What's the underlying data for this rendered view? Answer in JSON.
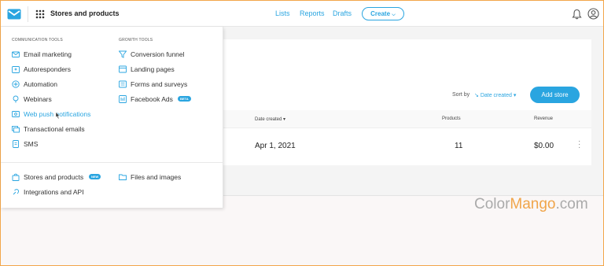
{
  "header": {
    "app_title": "Stores and products",
    "nav": [
      "Lists",
      "Reports",
      "Drafts"
    ],
    "create_label": "Create",
    "accent": "#2aa5e0"
  },
  "content": {
    "sort_label": "Sort by",
    "sort_value": "Date created",
    "add_store_label": "Add store",
    "columns": [
      "Date created",
      "Products",
      "Revenue"
    ],
    "rows": [
      {
        "date": "Apr 1, 2021",
        "products": "11",
        "revenue": "$0.00"
      }
    ]
  },
  "menu": {
    "communication_title": "COMMUNICATION TOOLS",
    "growth_title": "GROWTH TOOLS",
    "communication_items": [
      {
        "label": "Email marketing",
        "icon": "envelope-icon"
      },
      {
        "label": "Autoresponders",
        "icon": "autoresponder-icon"
      },
      {
        "label": "Automation",
        "icon": "automation-icon"
      },
      {
        "label": "Webinars",
        "icon": "webinar-icon"
      },
      {
        "label": "Web push notifications",
        "icon": "web-push-icon"
      },
      {
        "label": "Transactional emails",
        "icon": "transactional-email-icon"
      },
      {
        "label": "SMS",
        "icon": "sms-icon"
      }
    ],
    "growth_items": [
      {
        "label": "Conversion funnel",
        "icon": "funnel-icon"
      },
      {
        "label": "Landing pages",
        "icon": "landing-page-icon"
      },
      {
        "label": "Forms and surveys",
        "icon": "form-icon"
      },
      {
        "label": "Facebook Ads",
        "icon": "facebook-ads-icon",
        "badge": "BETA"
      }
    ],
    "bottom_items": [
      {
        "label": "Stores and products",
        "icon": "bag-icon",
        "badge": "NEW"
      },
      {
        "label": "Files and images",
        "icon": "folder-icon"
      },
      {
        "label": "Integrations and API",
        "icon": "integration-icon"
      }
    ]
  },
  "watermark": {
    "part1": "Color",
    "part2": "Mango",
    "part3": ".com"
  }
}
